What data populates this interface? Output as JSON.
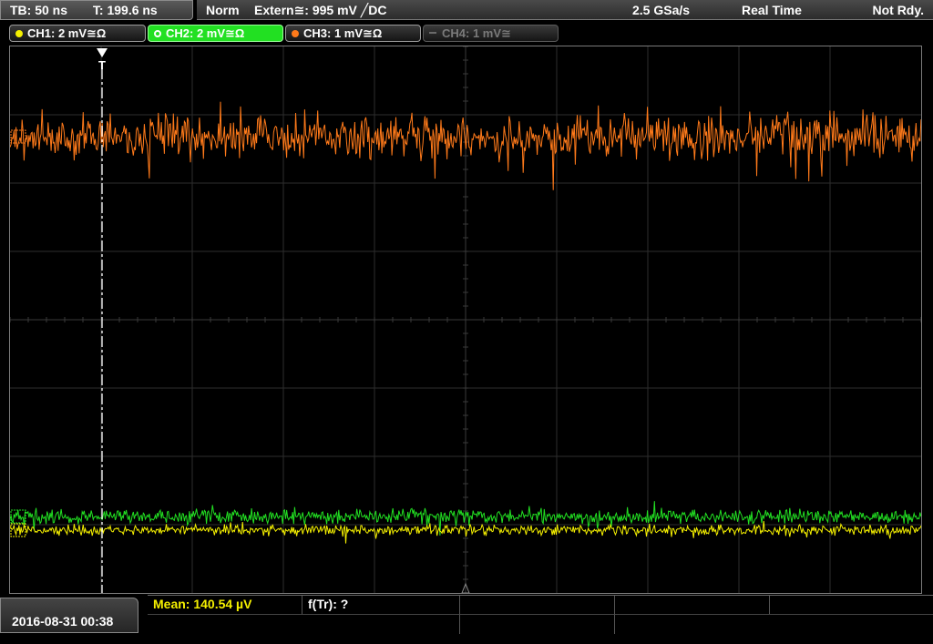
{
  "timebase": {
    "tb_label": "TB: 50 ns",
    "trigger_time_label": "T: 199.6 ns"
  },
  "trigger": {
    "mode": "Norm",
    "source": "Extern≅: 995 mV ╱DC",
    "sample_rate": "2.5 GSa/s",
    "acq_mode": "Real Time",
    "status": "Not Rdy."
  },
  "channels": [
    {
      "label": "CH1: 2 mV≅Ω",
      "color": "#f5f000",
      "active": true
    },
    {
      "label": "CH2: 2 mV≅Ω",
      "color": "#22e022",
      "active": true
    },
    {
      "label": "CH3: 1 mV≅Ω",
      "color": "#ff7a1a",
      "active": true
    },
    {
      "label": "CH4: 1 mV≅",
      "color": "#6a6a6a",
      "active": false
    }
  ],
  "screen": {
    "trigger_marker": "T",
    "grid_divisions": {
      "horizontal": 10,
      "vertical": 8
    },
    "traces": [
      {
        "channel": "CH3",
        "color": "#ff7a1a",
        "level_div": -2.68,
        "noise_div": 0.55
      },
      {
        "channel": "CH2",
        "color": "#22e022",
        "level_div": 2.88,
        "noise_div": 0.18
      },
      {
        "channel": "CH1",
        "color": "#f5f000",
        "level_div": 3.08,
        "noise_div": 0.13
      }
    ]
  },
  "footer": {
    "datetime": "2016-08-31 00:38",
    "measurements": [
      {
        "label": "Mean: 140.54 µV",
        "color": "#f5f000"
      },
      {
        "label": "f(Tr): ?",
        "color": "#ffffff"
      }
    ]
  }
}
